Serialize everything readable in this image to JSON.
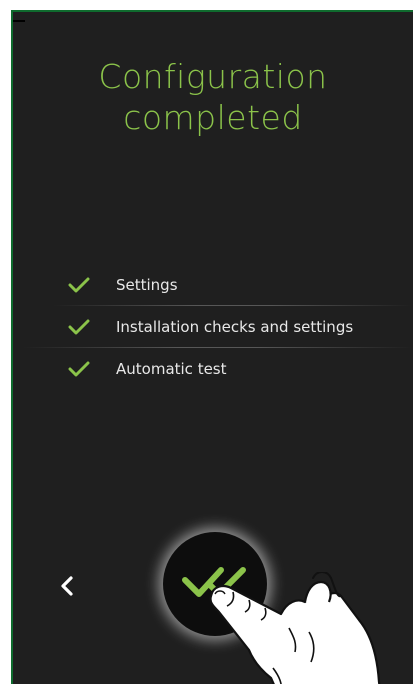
{
  "screen": {
    "title_line1": "Configuration",
    "title_line2": "completed"
  },
  "checklist": [
    {
      "label": "Settings",
      "icon": "checkmark-icon",
      "done": true
    },
    {
      "label": "Installation checks and settings",
      "icon": "checkmark-icon",
      "done": true
    },
    {
      "label": "Automatic test",
      "icon": "checkmark-icon",
      "done": true
    }
  ],
  "nav": {
    "back_icon": "chevron-left-icon",
    "confirm_icon": "double-checkmark-icon"
  },
  "colors": {
    "background": "#1f1f1f",
    "accent": "#8bc34a",
    "text": "#e8e8e8"
  }
}
